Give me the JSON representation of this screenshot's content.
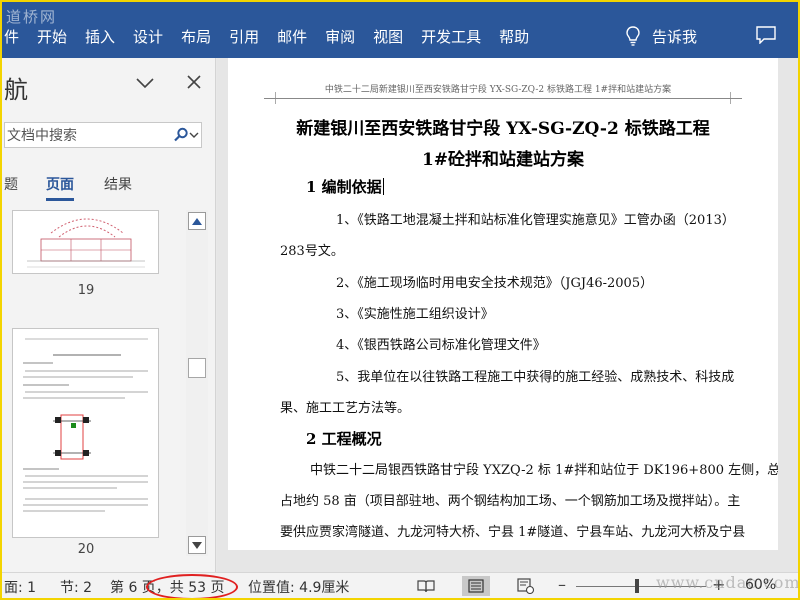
{
  "watermark_top": "道桥网",
  "ribbon": {
    "tabs": [
      "件",
      "开始",
      "插入",
      "设计",
      "布局",
      "引用",
      "邮件",
      "审阅",
      "视图",
      "开发工具",
      "帮助"
    ],
    "tell_me": "告诉我"
  },
  "nav": {
    "title": "航",
    "search_placeholder": "文档中搜索",
    "tabs": [
      "题",
      "页面",
      "结果"
    ],
    "page_numbers": [
      "19",
      "20"
    ]
  },
  "document": {
    "header": "中铁二十二局新建银川至西安铁路甘宁段 YX-SG-ZQ-2 标铁路工程 1#拌和站建站方案",
    "title_line1": "新建银川至西安铁路甘宁段 YX-SG-ZQ-2 标铁路工程",
    "title_line2": "1#砼拌和站建站方案",
    "section1": "1 编制依据",
    "items": [
      "1、《铁路工地混凝土拌和站标准化管理实施意见》工管办函（2013）",
      "283号文。",
      "2、《施工现场临时用电安全技术规范》（JGJ46-2005）",
      "3、《实施性施工组织设计》",
      "4、《银西铁路公司标准化管理文件》",
      "5、我单位在以往铁路工程施工中获得的施工经验、成熟技术、科技成",
      "果、施工工艺方法等。"
    ],
    "section2": "2 工程概况",
    "overview": [
      "中铁二十二局银西铁路甘宁段 YXZQ-2 标 1#拌和站位于 DK196+800 左侧，总",
      "占地约 58 亩（项目部驻地、两个钢结构加工场、一个钢筋加工场及搅拌站）。主",
      "要供应贾家湾隧道、九龙河特大桥、宁县 1#隧道、宁县车站、九龙河大桥及宁县"
    ]
  },
  "status": {
    "page": "面: 1",
    "section": "节: 2",
    "page_of": "第 6 页，共 53 页",
    "position": "位置值: 4.9厘米",
    "zoom": "60%"
  },
  "watermark_bottom": "www.cndao.com",
  "colors": {
    "ribbon": "#2b579a",
    "frame": "#f3d400",
    "highlight_circle": "#e02020"
  }
}
